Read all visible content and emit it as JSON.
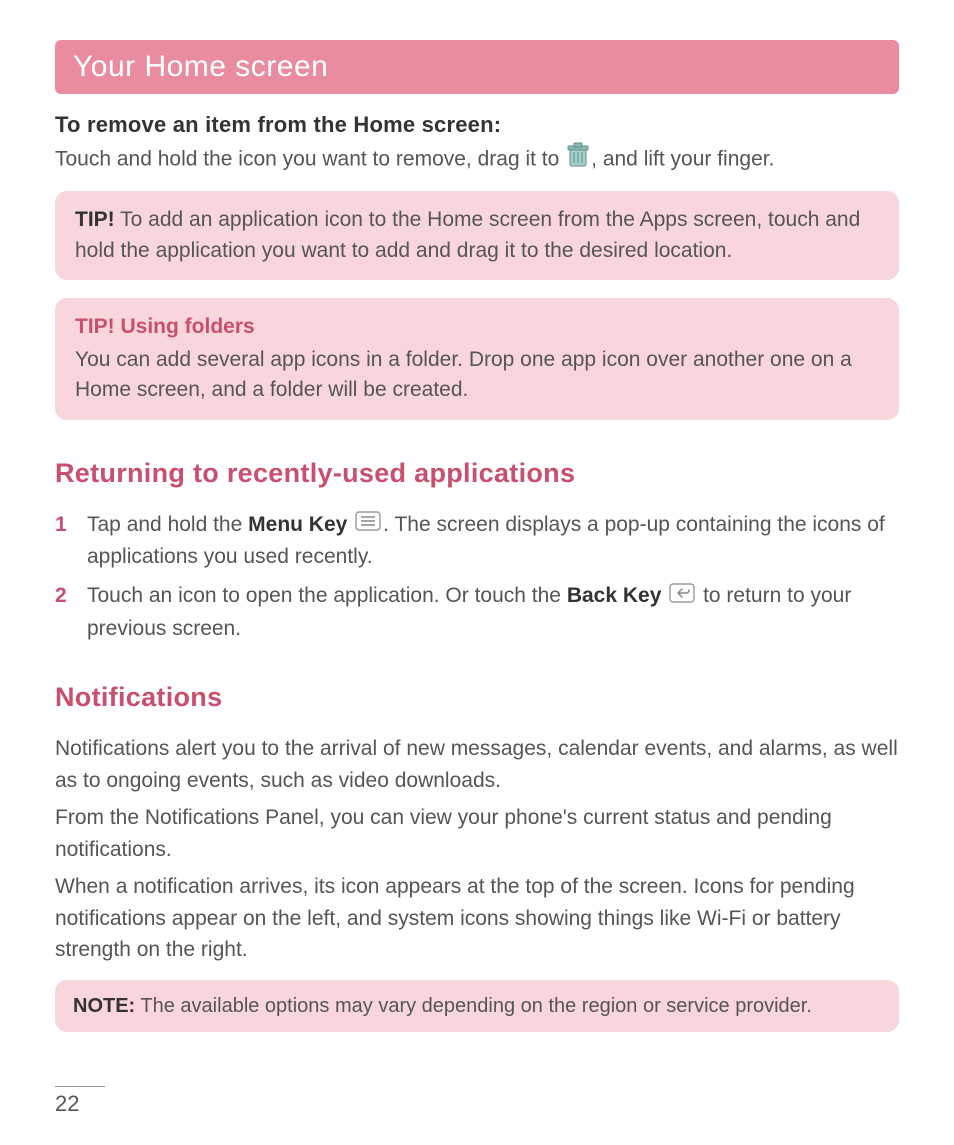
{
  "header": {
    "title": "Your Home screen"
  },
  "remove_section": {
    "heading": "To remove an item from the Home screen:",
    "text_before_icon": "Touch and hold the icon you want to remove, drag it to ",
    "icon_name": "trash-icon",
    "text_after_icon": ", and lift your finger."
  },
  "tip1": {
    "label": "TIP!",
    "text": " To add an application icon to the Home screen from the Apps screen, touch and hold the application you want to add and drag it to the desired location."
  },
  "tip2": {
    "title": "TIP! Using folders",
    "text": "You can add several app icons in a folder. Drop one app icon over another one on a Home screen, and a folder will be created."
  },
  "returning_section": {
    "heading": "Returning to recently-used applications",
    "items": [
      {
        "num": "1",
        "before1": "Tap and hold the ",
        "bold1": "Menu Key",
        "icon1": "menu-key-icon",
        "after1": ". The screen displays a pop-up containing the icons of applications you used recently."
      },
      {
        "num": "2",
        "before1": "Touch an icon to open the application. Or touch the ",
        "bold1": "Back Key",
        "icon1": "back-key-icon",
        "after1": " to return to your previous screen."
      }
    ]
  },
  "notifications_section": {
    "heading": "Notifications",
    "paras": [
      "Notifications alert you to the arrival of new messages, calendar events, and alarms, as well as to ongoing events, such as video downloads.",
      "From the Notifications Panel, you can view your phone's current status and pending notifications.",
      "When a notification arrives, its icon appears at the top of the screen. Icons for pending notifications appear on the left, and system icons showing things like Wi-Fi or battery strength on the right."
    ]
  },
  "note": {
    "label": "NOTE:",
    "text": " The available options may vary depending on the region or service provider."
  },
  "page_number": "22"
}
